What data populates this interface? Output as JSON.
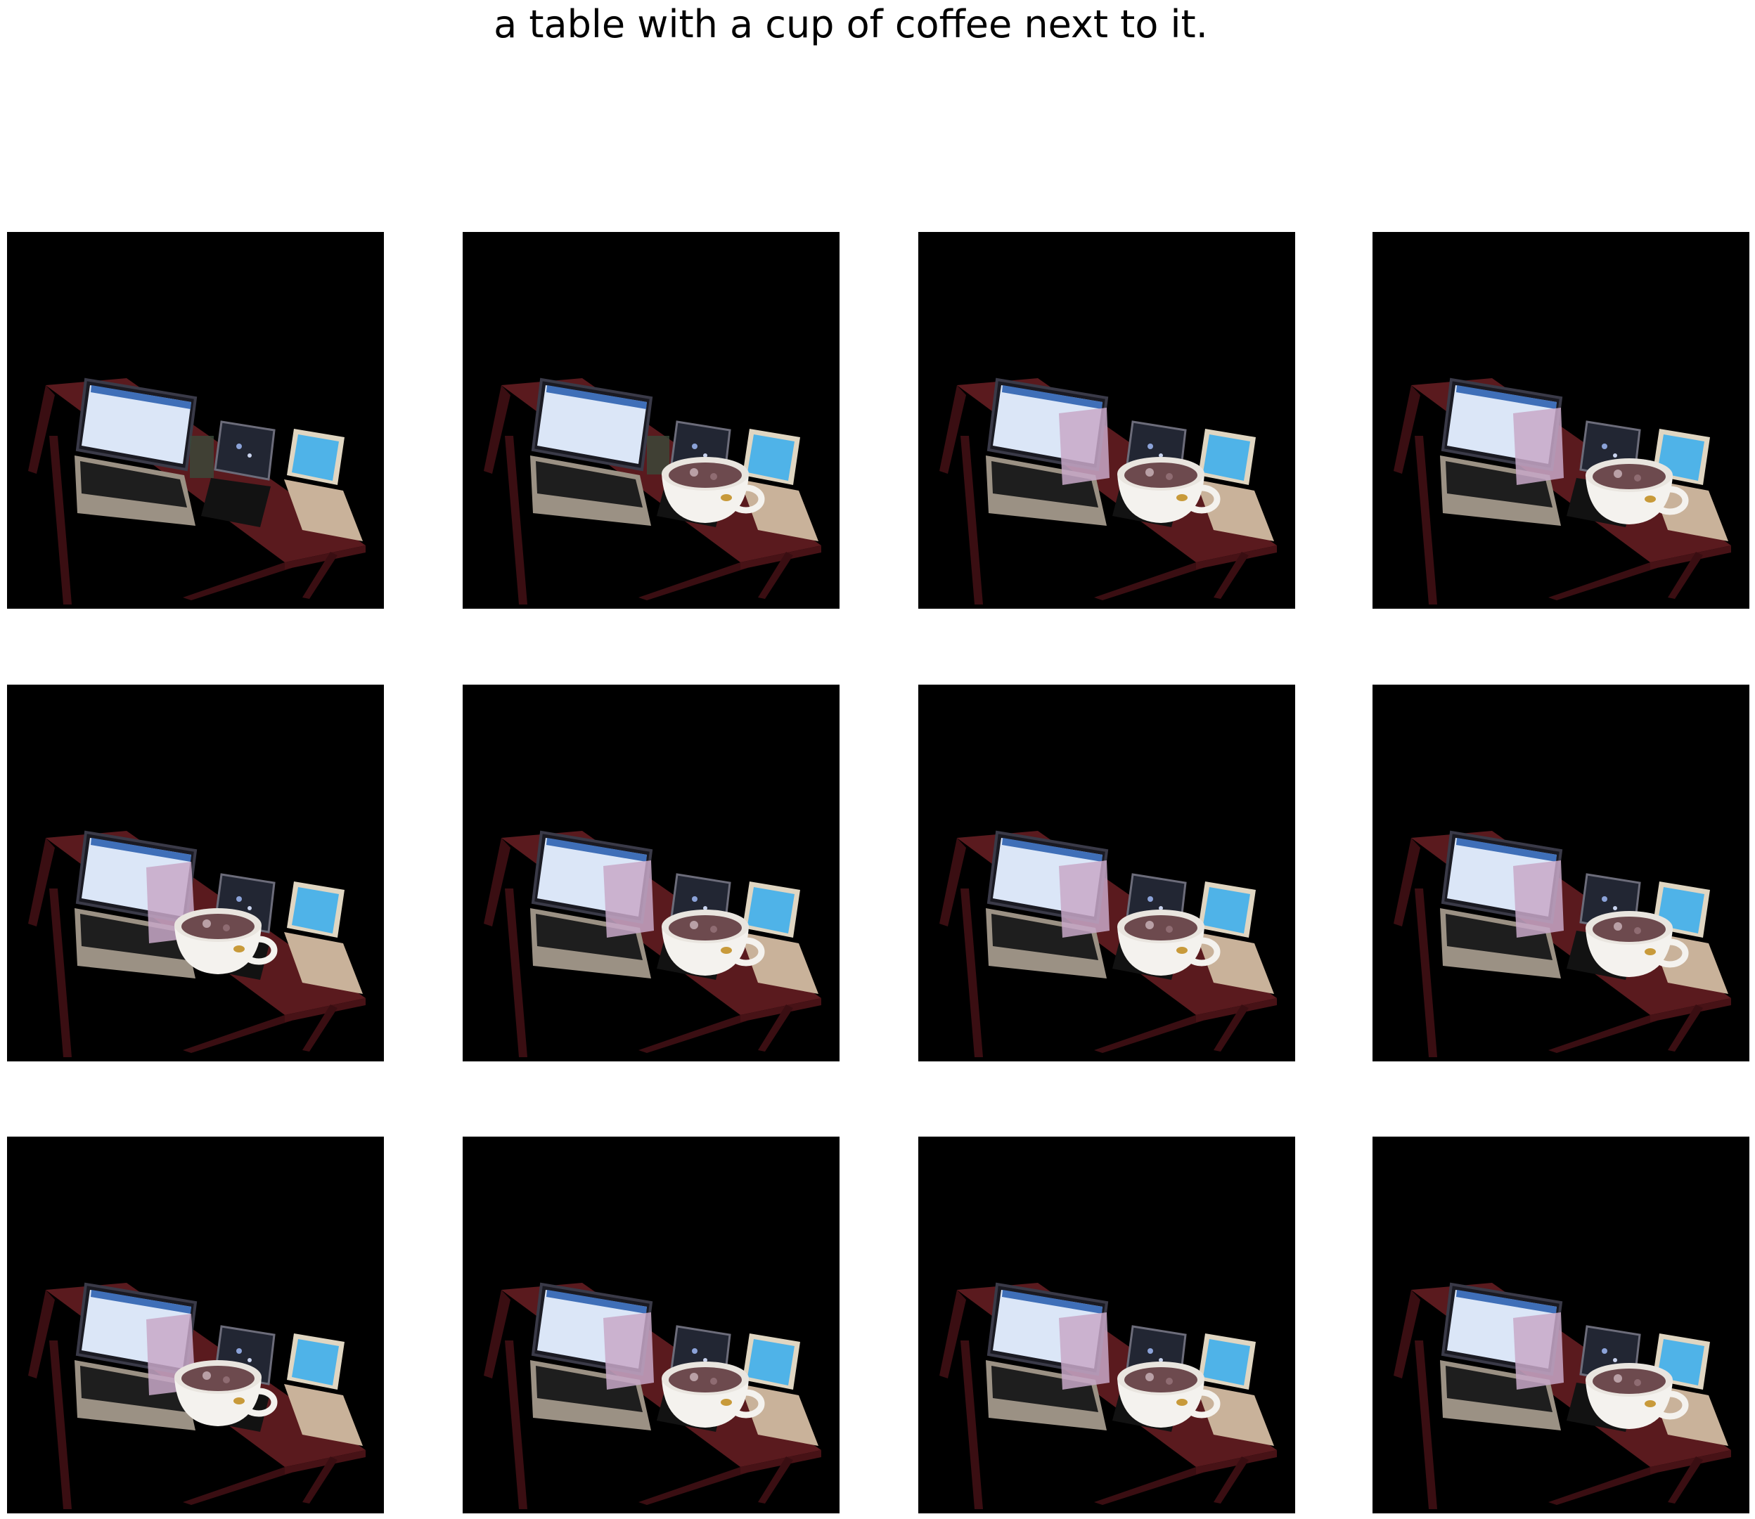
{
  "figure": {
    "title": "a table with a cup of coffee next to it.",
    "panels": [
      {
        "variant": "original"
      },
      {
        "variant": "cup-center"
      },
      {
        "variant": "cup-center-glass"
      },
      {
        "variant": "cup-right-glass"
      },
      {
        "variant": "cup-left-glass"
      },
      {
        "variant": "cup-center-glass"
      },
      {
        "variant": "cup-center-glass"
      },
      {
        "variant": "cup-right-glass"
      },
      {
        "variant": "cup-left-glass"
      },
      {
        "variant": "cup-center-glass"
      },
      {
        "variant": "cup-center-glass"
      },
      {
        "variant": "cup-right-glass"
      }
    ]
  },
  "colors": {
    "background": "#000000",
    "table": "#5a1a1e",
    "table_edge": "#3a0e12",
    "laptop_screen": "#dbe6f7",
    "laptop_screen_blue": "#2aa9e0",
    "laptop_body": "#9b9184",
    "keyboard": "#1e1e1e",
    "cup": "#f4f2ee",
    "coffee": "#6d4a4e",
    "glass": "#c8a8c8",
    "tablet_screen": "#4fb3e8",
    "tablet_body": "#c9b29a"
  }
}
